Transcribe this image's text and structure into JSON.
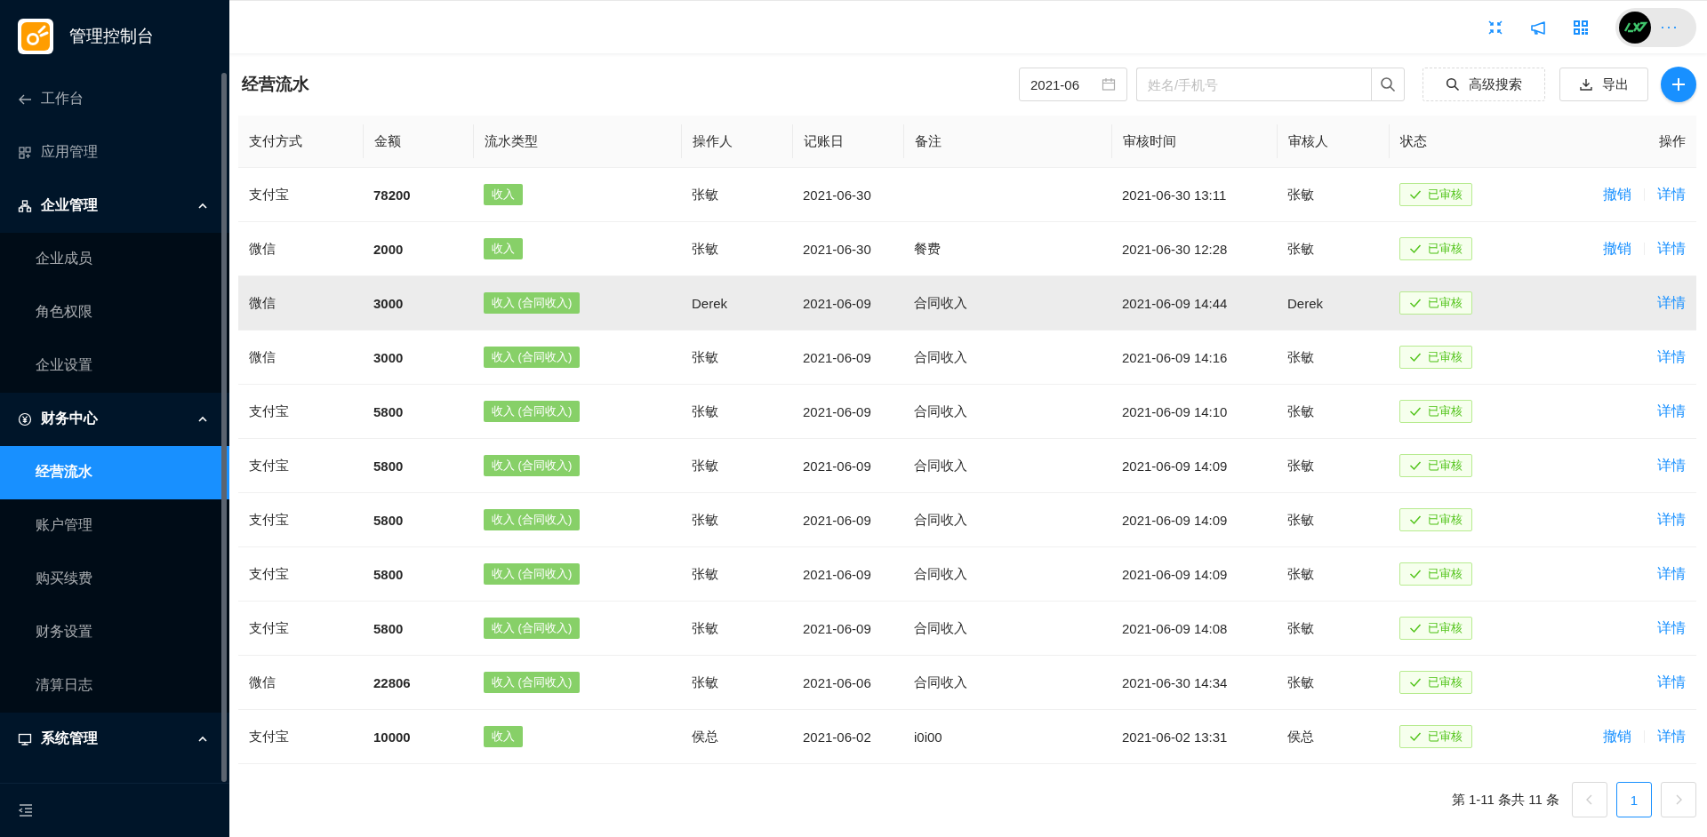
{
  "sidebar": {
    "title": "管理控制台",
    "menu": [
      {
        "label": "工作台",
        "kind": "back"
      },
      {
        "label": "应用管理",
        "kind": "link"
      },
      {
        "label": "企业管理",
        "kind": "group",
        "expanded": true,
        "children": [
          {
            "label": "企业成员",
            "selected": false
          },
          {
            "label": "角色权限",
            "selected": false
          },
          {
            "label": "企业设置",
            "selected": false
          }
        ]
      },
      {
        "label": "财务中心",
        "kind": "group",
        "expanded": true,
        "children": [
          {
            "label": "经营流水",
            "selected": true
          },
          {
            "label": "账户管理",
            "selected": false
          },
          {
            "label": "购买续费",
            "selected": false
          },
          {
            "label": "财务设置",
            "selected": false
          },
          {
            "label": "清算日志",
            "selected": false
          }
        ]
      },
      {
        "label": "系统管理",
        "kind": "group",
        "expanded": true
      }
    ]
  },
  "header": {
    "more": "···"
  },
  "page": {
    "title": "经营流水",
    "month": "2021-06",
    "search": {
      "placeholder": "姓名/手机号"
    },
    "advanced_search": "高级搜索",
    "export": "导出"
  },
  "table": {
    "columns": [
      "支付方式",
      "金额",
      "流水类型",
      "操作人",
      "记账日",
      "备注",
      "审核时间",
      "审核人",
      "状态",
      "操作"
    ],
    "rows": [
      {
        "payment": "支付宝",
        "amount": "78200",
        "type": "收入",
        "operator": "张敏",
        "date": "2021-06-30",
        "note": "",
        "audit_time": "2021-06-30 13:11",
        "auditor": "张敏",
        "status": "已审核",
        "actions": [
          "撤销",
          "详情"
        ],
        "highlighted": false
      },
      {
        "payment": "微信",
        "amount": "2000",
        "type": "收入",
        "operator": "张敏",
        "date": "2021-06-30",
        "note": "餐费",
        "audit_time": "2021-06-30 12:28",
        "auditor": "张敏",
        "status": "已审核",
        "actions": [
          "撤销",
          "详情"
        ],
        "highlighted": false
      },
      {
        "payment": "微信",
        "amount": "3000",
        "type": "收入 (合同收入)",
        "operator": "Derek",
        "date": "2021-06-09",
        "note": "合同收入",
        "audit_time": "2021-06-09 14:44",
        "auditor": "Derek",
        "status": "已审核",
        "actions": [
          "详情"
        ],
        "highlighted": true
      },
      {
        "payment": "微信",
        "amount": "3000",
        "type": "收入 (合同收入)",
        "operator": "张敏",
        "date": "2021-06-09",
        "note": "合同收入",
        "audit_time": "2021-06-09 14:16",
        "auditor": "张敏",
        "status": "已审核",
        "actions": [
          "详情"
        ],
        "highlighted": false
      },
      {
        "payment": "支付宝",
        "amount": "5800",
        "type": "收入 (合同收入)",
        "operator": "张敏",
        "date": "2021-06-09",
        "note": "合同收入",
        "audit_time": "2021-06-09 14:10",
        "auditor": "张敏",
        "status": "已审核",
        "actions": [
          "详情"
        ],
        "highlighted": false
      },
      {
        "payment": "支付宝",
        "amount": "5800",
        "type": "收入 (合同收入)",
        "operator": "张敏",
        "date": "2021-06-09",
        "note": "合同收入",
        "audit_time": "2021-06-09 14:09",
        "auditor": "张敏",
        "status": "已审核",
        "actions": [
          "详情"
        ],
        "highlighted": false
      },
      {
        "payment": "支付宝",
        "amount": "5800",
        "type": "收入 (合同收入)",
        "operator": "张敏",
        "date": "2021-06-09",
        "note": "合同收入",
        "audit_time": "2021-06-09 14:09",
        "auditor": "张敏",
        "status": "已审核",
        "actions": [
          "详情"
        ],
        "highlighted": false
      },
      {
        "payment": "支付宝",
        "amount": "5800",
        "type": "收入 (合同收入)",
        "operator": "张敏",
        "date": "2021-06-09",
        "note": "合同收入",
        "audit_time": "2021-06-09 14:09",
        "auditor": "张敏",
        "status": "已审核",
        "actions": [
          "详情"
        ],
        "highlighted": false
      },
      {
        "payment": "支付宝",
        "amount": "5800",
        "type": "收入 (合同收入)",
        "operator": "张敏",
        "date": "2021-06-09",
        "note": "合同收入",
        "audit_time": "2021-06-09 14:08",
        "auditor": "张敏",
        "status": "已审核",
        "actions": [
          "详情"
        ],
        "highlighted": false
      },
      {
        "payment": "微信",
        "amount": "22806",
        "type": "收入 (合同收入)",
        "operator": "张敏",
        "date": "2021-06-06",
        "note": "合同收入",
        "audit_time": "2021-06-30 14:34",
        "auditor": "张敏",
        "status": "已审核",
        "actions": [
          "详情"
        ],
        "highlighted": false
      },
      {
        "payment": "支付宝",
        "amount": "10000",
        "type": "收入",
        "operator": "侯总",
        "date": "2021-06-02",
        "note": "i0i00",
        "audit_time": "2021-06-02 13:31",
        "auditor": "侯总",
        "status": "已审核",
        "actions": [
          "撤销",
          "详情"
        ],
        "highlighted": false
      }
    ]
  },
  "pagination": {
    "summary": "第 1-11 条共 11 条",
    "prev": {
      "disabled": true
    },
    "next": {
      "disabled": true
    },
    "pages": [
      {
        "label": "1",
        "selected": true
      }
    ]
  }
}
